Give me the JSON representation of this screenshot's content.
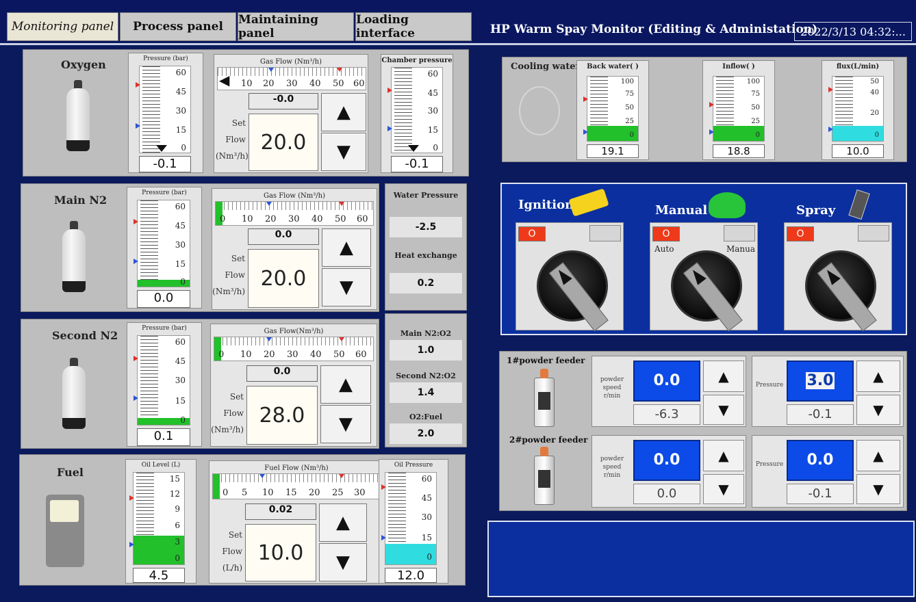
{
  "tabs": [
    {
      "label": "Monitoring panel",
      "active": true
    },
    {
      "label": "Process panel",
      "active": false
    },
    {
      "label": "Maintaining panel",
      "active": false
    },
    {
      "label": "Loading interface",
      "active": false
    }
  ],
  "app_title": "HP Warm Spay Monitor (Editing & Administation)",
  "datetime": "2022/3/13 04:32:...",
  "gases": {
    "oxygen": {
      "label": "Oxygen",
      "pressure": {
        "title": "Pressure (bar)",
        "ticks": [
          "60",
          "45",
          "30",
          "15",
          "0"
        ],
        "value": "-0.1",
        "fill_fraction": 0
      },
      "flow": {
        "title": "Gas Flow (Nm³/h)",
        "ticks": [
          "10",
          "20",
          "30",
          "40",
          "50",
          "60"
        ],
        "actual": "-0.0",
        "set": "20.0",
        "set_label_1": "Set",
        "set_label_2": "Flow",
        "set_label_3": "(Nm³/h)",
        "fill_fraction": 0
      },
      "chamber": {
        "title": "Chamber pressure",
        "ticks": [
          "60",
          "45",
          "30",
          "15",
          "0"
        ],
        "value": "-0.1"
      }
    },
    "main_n2": {
      "label": "Main N2",
      "pressure": {
        "title": "Pressure (bar)",
        "ticks": [
          "60",
          "45",
          "30",
          "15",
          "0"
        ],
        "value": "0.0",
        "fill_fraction": 0.02
      },
      "flow": {
        "title": "Gas Flow (Nm³/h)",
        "ticks": [
          "0",
          "10",
          "20",
          "30",
          "40",
          "50",
          "60"
        ],
        "actual": "0.0",
        "set": "20.0",
        "set_label_1": "Set",
        "set_label_2": "Flow",
        "set_label_3": "(Nm³/h)",
        "fill_fraction": 0.02
      }
    },
    "second_n2": {
      "label": "Second N2",
      "pressure": {
        "title": "Pressure (bar)",
        "ticks": [
          "60",
          "45",
          "30",
          "15",
          "0"
        ],
        "value": "0.1",
        "fill_fraction": 0.02
      },
      "flow": {
        "title": "Gas Flow(Nm³/h)",
        "ticks": [
          "0",
          "10",
          "20",
          "30",
          "40",
          "50",
          "60"
        ],
        "actual": "0.0",
        "set": "28.0",
        "set_label_1": "Set",
        "set_label_2": "Flow",
        "set_label_3": "(Nm³/h)",
        "fill_fraction": 0.02
      }
    },
    "fuel": {
      "label": "Fuel",
      "level": {
        "title": "Oil Level (L)",
        "ticks": [
          "15",
          "12",
          "9",
          "6",
          "3",
          "0"
        ],
        "value": "4.5",
        "fill_fraction": 0.3
      },
      "flow": {
        "title": "Fuel Flow (Nm³/h)",
        "ticks": [
          "0",
          "5",
          "10",
          "15",
          "20",
          "25",
          "30"
        ],
        "actual": "0.02",
        "set": "10.0",
        "set_label_1": "Set",
        "set_label_2": "Flow",
        "set_label_3": "(L/h)",
        "fill_fraction": 0.02
      },
      "oil_pressure": {
        "title": "Oil Pressure",
        "ticks": [
          "60",
          "45",
          "30",
          "15",
          "0"
        ],
        "value": "12.0",
        "fill_fraction": 0.2
      }
    }
  },
  "info": [
    {
      "label": "Water Pressure",
      "value": "-2.5"
    },
    {
      "label": "Heat exchange",
      "value": "0.2"
    },
    {
      "label": "Main N2:O2",
      "value": "1.0"
    },
    {
      "label": "Second N2:O2",
      "value": "1.4"
    },
    {
      "label": "O2:Fuel",
      "value": "2.0"
    }
  ],
  "cooling": {
    "label": "Cooling water",
    "gauges": [
      {
        "title": "Back water( )",
        "ticks": [
          "100",
          "75",
          "50",
          "25",
          "0"
        ],
        "value": "19.1",
        "fill_fraction": 0.19,
        "fill_color": "#22c02a"
      },
      {
        "title": "Inflow( )",
        "ticks": [
          "100",
          "75",
          "50",
          "25",
          "0"
        ],
        "value": "18.8",
        "fill_fraction": 0.19,
        "fill_color": "#22c02a"
      },
      {
        "title": "flux(L/min)",
        "ticks": [
          "50",
          "40",
          "20",
          "0"
        ],
        "value": "10.0",
        "fill_fraction": 0.2,
        "fill_color": "#2fdde0"
      }
    ]
  },
  "switches": [
    {
      "label": "Ignition",
      "indicator": "O",
      "left_label": "",
      "right_label": ""
    },
    {
      "label": "Manual",
      "indicator": "O",
      "left_label": "Auto",
      "right_label": "Manua"
    },
    {
      "label": "Spray",
      "indicator": "O",
      "left_label": "",
      "right_label": ""
    }
  ],
  "feeders": [
    {
      "label": "1#powder feeder",
      "speed_label": "powder speed",
      "speed_unit": "r/min",
      "speed_set": "0.0",
      "speed_actual": "-6.3",
      "pressure_label": "Pressure",
      "pressure_set": "3.0",
      "pressure_actual": "-0.1"
    },
    {
      "label": "2#powder feeder",
      "speed_label": "powder speed",
      "speed_unit": "r/min",
      "speed_set": "0.0",
      "speed_actual": "0.0",
      "pressure_label": "Pressure",
      "pressure_set": "0.0",
      "pressure_actual": "-0.1"
    }
  ],
  "icons": {
    "up": "▲",
    "down": "▼",
    "back": "◀"
  },
  "colors": {
    "background": "#0b1a5c",
    "green_fill": "#22c02a",
    "cyan_fill": "#2fdde0",
    "indicator_red": "#ee3a1a",
    "value_blue": "#0c4be8"
  }
}
